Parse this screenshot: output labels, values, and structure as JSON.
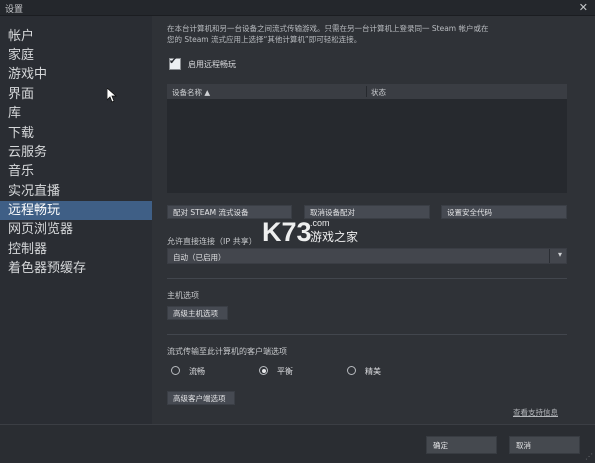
{
  "window": {
    "title": "设置",
    "close_symbol": "✕"
  },
  "sidebar": {
    "items": [
      {
        "label": "帐户",
        "active": false
      },
      {
        "label": "家庭",
        "active": false
      },
      {
        "label": "游戏中",
        "active": false
      },
      {
        "label": "界面",
        "active": false
      },
      {
        "label": "库",
        "active": false
      },
      {
        "label": "下载",
        "active": false
      },
      {
        "label": "云服务",
        "active": false
      },
      {
        "label": "音乐",
        "active": false
      },
      {
        "label": "实况直播",
        "active": false
      },
      {
        "label": "远程畅玩",
        "active": true
      },
      {
        "label": "网页浏览器",
        "active": false
      },
      {
        "label": "控制器",
        "active": false
      },
      {
        "label": "着色器预缓存",
        "active": false
      }
    ]
  },
  "remote_play": {
    "description_line1": "在本台计算机和另一台设备之间流式传输游戏。只需在另一台计算机上登录同一 Steam 帐户或在",
    "description_line2": "您的 Steam 流式应用上选择“其他计算机”即可轻松连接。",
    "enable_label": "启用远程畅玩",
    "enable_checked": true,
    "table": {
      "col_device": "设备名称 ▲",
      "col_status": "状态"
    },
    "buttons": {
      "pair": "配对 STEAM 流式设备",
      "unpair": "取消设备配对",
      "security_code": "设置安全代码"
    },
    "direct_connection_label": "允许直接连接（IP 共享）",
    "direct_connection_value": "自动（已启用）",
    "host_options_label": "主机选项",
    "advanced_host_button": "高级主机选项",
    "client_options_label": "流式传输至此计算机的客户端选项",
    "radio_options": [
      {
        "label": "流畅",
        "selected": false
      },
      {
        "label": "平衡",
        "selected": true
      },
      {
        "label": "精美",
        "selected": false
      }
    ],
    "advanced_client_button": "高级客户端选项",
    "support_link": "查看支持信息"
  },
  "footer": {
    "ok": "确定",
    "cancel": "取消"
  },
  "watermark": {
    "brand": "K73",
    "site": "游戏之家",
    "domain": ".com"
  },
  "colors": {
    "accent": "#3f5f86",
    "background": "#2f3237",
    "sidebar": "#2a2d33"
  }
}
